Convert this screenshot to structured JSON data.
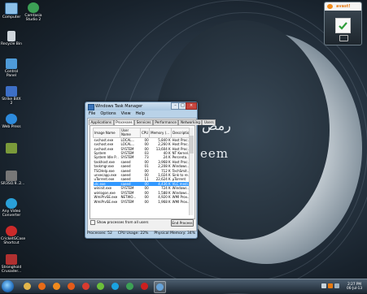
{
  "wallpaper": {
    "arabic_text": "رمض",
    "latin_text": "eem"
  },
  "desktop_icons": [
    {
      "label": "Computer",
      "icon": "computer-icon",
      "color": "#8cc0e8"
    },
    {
      "label": "Camtasia Studio 2",
      "icon": "camtasia-icon",
      "color": "#3ca055"
    },
    {
      "label": "Recycle Bin",
      "icon": "recycle-bin-icon",
      "color": "#cfd6dc"
    },
    {
      "label": "Control Panel",
      "icon": "control-panel-icon",
      "color": "#4f9bd8"
    },
    {
      "label": "Strike BitX 2",
      "icon": "app-icon",
      "color": "#3d6fc7"
    },
    {
      "label": "Web Press",
      "icon": "web-icon",
      "color": "#2d8bdd"
    },
    {
      "label": "",
      "icon": "app-grid-icon",
      "color": "#7a9a3a"
    },
    {
      "label": "SR3SO.9..2...",
      "icon": "app-icon",
      "color": "#777777"
    },
    {
      "label": "Any Video Converter",
      "icon": "video-converter-icon",
      "color": "#2aa0d8"
    },
    {
      "label": "CricketGCase Shortcut",
      "icon": "cricket-icon",
      "color": "#cc2a2a"
    },
    {
      "label": "Stronghold Crusader...",
      "icon": "game-icon",
      "color": "#b03030"
    }
  ],
  "gadget": {
    "brand": "avast!",
    "status": "protected"
  },
  "task_manager": {
    "title": "Windows Task Manager",
    "menu": [
      "File",
      "Options",
      "View",
      "Help"
    ],
    "tabs": [
      "Applications",
      "Processes",
      "Services",
      "Performance",
      "Networking",
      "Users"
    ],
    "active_tab": "Processes",
    "columns": [
      "Image Name",
      "User Name",
      "CPU",
      "Memory (...",
      "Description"
    ],
    "rows": [
      [
        "svchost.exe",
        "LOCAL...",
        "00",
        "5,840 K",
        "Host Proc..."
      ],
      [
        "svchost.exe",
        "LOCAL...",
        "00",
        "2,260 K",
        "Host Proc..."
      ],
      [
        "svchost.exe",
        "SYSTEM",
        "00",
        "13,604 K",
        "Host Proc..."
      ],
      [
        "System",
        "SYSTEM",
        "03",
        "40 K",
        "NT Kernel..."
      ],
      [
        "System Idle P...",
        "SYSTEM",
        "73",
        "24 K",
        "Percenta..."
      ],
      [
        "taskhost.exe",
        "saeed",
        "00",
        "3,968 K",
        "Host Proc..."
      ],
      [
        "taskmgr.exe",
        "saeed",
        "01",
        "2,208 K",
        "Windows..."
      ],
      [
        "TSCHelp.exe",
        "saeed",
        "00",
        "712 K",
        "TechSmit..."
      ],
      [
        "unsecapp.exe",
        "saeed",
        "00",
        "1,024 K",
        "Sink to re..."
      ],
      [
        "uTorrent.exe",
        "saeed",
        "11",
        "22,624 K",
        "µTorrent"
      ],
      [
        "vlc.exe",
        "saeed",
        "00",
        "4,436 K",
        "VLC medi..."
      ],
      [
        "wininit.exe",
        "SYSTEM",
        "00",
        "724 K",
        "Windows..."
      ],
      [
        "winlogon.exe",
        "SYSTEM",
        "00",
        "1,588 K",
        "Windows..."
      ],
      [
        "WmiPrvSE.exe",
        "NETWO...",
        "00",
        "4,920 K",
        "WMI Prov..."
      ],
      [
        "WmiPrvSE.exe",
        "SYSTEM",
        "00",
        "1,968 K",
        "WMI Prov..."
      ]
    ],
    "selected_row": 10,
    "show_all_label": "Show processes from all users",
    "end_process_label": "End Process",
    "status": {
      "processes": "Processes: 52",
      "cpu": "CPU Usage: 22%",
      "memory": "Physical Memory: 34%"
    }
  },
  "taskbar": {
    "items": [
      {
        "icon": "explorer-icon",
        "color": "#e3b64a"
      },
      {
        "icon": "media-player-icon",
        "color": "#e86b17"
      },
      {
        "icon": "vlc-icon",
        "color": "#f08a1d"
      },
      {
        "icon": "firefox-icon",
        "color": "#e55b1a"
      },
      {
        "icon": "chrome-icon",
        "color": "#d93b2f"
      },
      {
        "icon": "utorrent-icon",
        "color": "#6bbf3a"
      },
      {
        "icon": "skype-icon",
        "color": "#1aa2e0"
      },
      {
        "icon": "camtasia-icon",
        "color": "#3ca055"
      },
      {
        "icon": "opera-icon",
        "color": "#cc1f1f"
      },
      {
        "icon": "task-manager-icon",
        "color": "#66a3d9"
      }
    ],
    "clock_time": "2:27 PM",
    "clock_date": "06-Jul-13"
  }
}
